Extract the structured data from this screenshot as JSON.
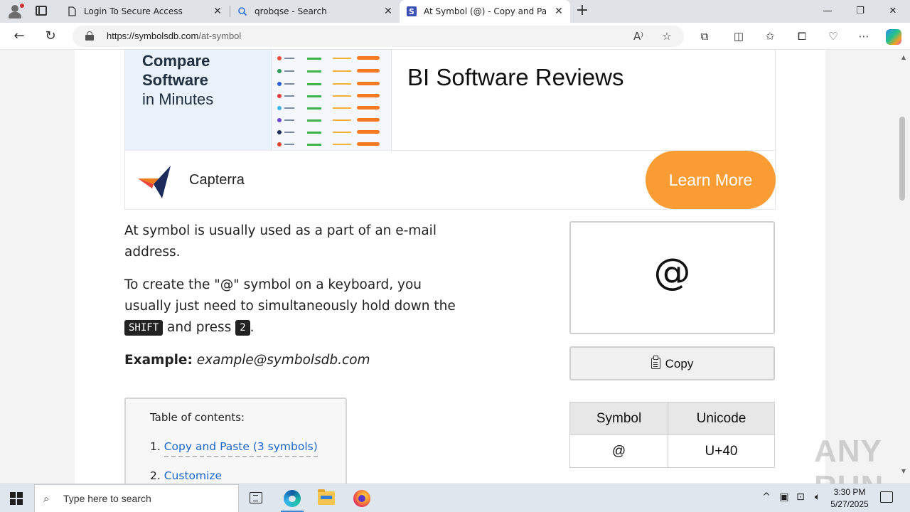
{
  "browser": {
    "tabs": [
      {
        "title": "Login To Secure Access",
        "icon": "page-icon",
        "active": false
      },
      {
        "title": "qrobqse - Search",
        "icon": "search-icon",
        "active": false
      },
      {
        "title": "At Symbol (@) - Copy and Paste",
        "icon": "symbolsdb-favicon",
        "active": true
      }
    ],
    "url_host": "https://symbolsdb.com",
    "url_path": "/at-symbol",
    "window_controls": {
      "minimize": "—",
      "restore": "❐",
      "close": "✕"
    }
  },
  "ad": {
    "headline_bold": [
      "Compare",
      "Software"
    ],
    "headline_normal": "in Minutes",
    "title": "BI Software Reviews",
    "brand": "Capterra",
    "cta": "Learn More",
    "brand_colors": {
      "cta": "#f89c33",
      "logo_blue": "#1ea1e6",
      "logo_orange": "#f57b20",
      "logo_red": "#e8443a",
      "logo_navy": "#1d2a5c"
    }
  },
  "article": {
    "para1": "At symbol is usually used as a part of an e-mail address.",
    "para2_before": "To create the \"@\" symbol on a keyboard, you usually just need to simultaneously hold down the ",
    "key1": "SHIFT",
    "para2_middle": " and press ",
    "key2": "2",
    "para2_after": ".",
    "example_label": "Example:",
    "example_value": "example@symbolsdb.com"
  },
  "toc": {
    "title": "Table of contents:",
    "items": [
      {
        "num": "1.",
        "label": "Copy and Paste (3 symbols)"
      },
      {
        "num": "2.",
        "label": "Customize"
      }
    ]
  },
  "symbol": {
    "char": "@",
    "copy_label": "Copy",
    "table": {
      "headers": [
        "Symbol",
        "Unicode"
      ],
      "rows": [
        [
          "@",
          "U+40"
        ]
      ]
    }
  },
  "watermark": "ANY RUN",
  "taskbar": {
    "search_placeholder": "Type here to search",
    "time": "3:30 PM",
    "date": "5/27/2025"
  }
}
